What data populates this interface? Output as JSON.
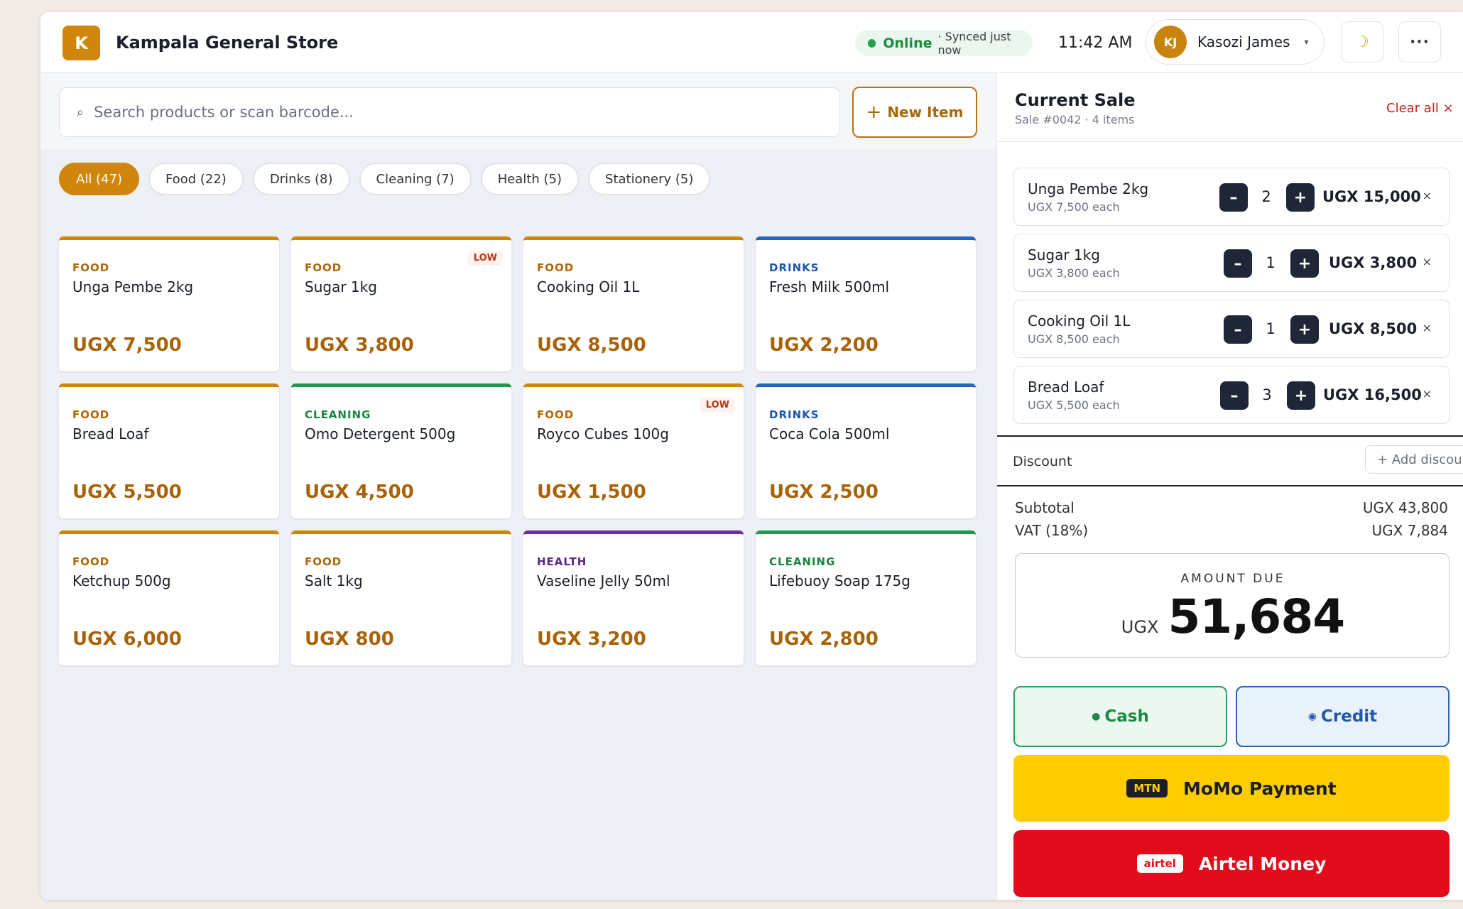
{
  "header": {
    "logo_letter": "K",
    "store_name": "Kampala General Store",
    "status_online": "Online",
    "status_sync": "· Synced just now",
    "time": "11:42 AM",
    "user_initials": "KJ",
    "user_name": "Kasozi James",
    "caret": "▾",
    "moon_glyph": "☽",
    "more_glyph": "···"
  },
  "search": {
    "placeholder": "Search products or scan barcode...",
    "new_item_label": "New Item"
  },
  "filters": [
    {
      "label": "All (47)",
      "active": true
    },
    {
      "label": "Food (22)",
      "active": false
    },
    {
      "label": "Drinks (8)",
      "active": false
    },
    {
      "label": "Cleaning (7)",
      "active": false
    },
    {
      "label": "Health (5)",
      "active": false
    },
    {
      "label": "Stationery (5)",
      "active": false
    }
  ],
  "products": [
    {
      "category": "FOOD",
      "name": "Unga Pembe 2kg",
      "price": "UGX 7,500",
      "badge": ""
    },
    {
      "category": "FOOD",
      "name": "Sugar 1kg",
      "price": "UGX 3,800",
      "badge": "LOW"
    },
    {
      "category": "FOOD",
      "name": "Cooking Oil 1L",
      "price": "UGX 8,500",
      "badge": ""
    },
    {
      "category": "DRINKS",
      "name": "Fresh Milk 500ml",
      "price": "UGX 2,200",
      "badge": ""
    },
    {
      "category": "FOOD",
      "name": "Bread Loaf",
      "price": "UGX 5,500",
      "badge": ""
    },
    {
      "category": "CLEANING",
      "name": "Omo Detergent 500g",
      "price": "UGX 4,500",
      "badge": ""
    },
    {
      "category": "FOOD",
      "name": "Royco Cubes 100g",
      "price": "UGX 1,500",
      "badge": "LOW"
    },
    {
      "category": "DRINKS",
      "name": "Coca Cola 500ml",
      "price": "UGX 2,500",
      "badge": ""
    },
    {
      "category": "FOOD",
      "name": "Ketchup 500g",
      "price": "UGX 6,000",
      "badge": ""
    },
    {
      "category": "FOOD",
      "name": "Salt 1kg",
      "price": "UGX 800",
      "badge": ""
    },
    {
      "category": "HEALTH",
      "name": "Vaseline Jelly 50ml",
      "price": "UGX 3,200",
      "badge": ""
    },
    {
      "category": "CLEANING",
      "name": "Lifebuoy Soap 175g",
      "price": "UGX 2,800",
      "badge": ""
    }
  ],
  "sale": {
    "title": "Current Sale",
    "subtitle": "Sale #0042 · 4 items",
    "clear_all": "Clear all ×",
    "items": [
      {
        "name": "Unga Pembe 2kg",
        "each": "UGX 7,500 each",
        "qty": "2",
        "total": "UGX 15,000"
      },
      {
        "name": "Sugar 1kg",
        "each": "UGX 3,800 each",
        "qty": "1",
        "total": "UGX 3,800"
      },
      {
        "name": "Cooking Oil 1L",
        "each": "UGX 8,500 each",
        "qty": "1",
        "total": "UGX 8,500"
      },
      {
        "name": "Bread Loaf",
        "each": "UGX 5,500 each",
        "qty": "3",
        "total": "UGX 16,500"
      }
    ],
    "minus_glyph": "–",
    "plus_glyph": "+",
    "remove_glyph": "×",
    "discount_label": "Discount",
    "add_discount": "+ Add discount",
    "subtotal_label": "Subtotal",
    "subtotal_value": "UGX 43,800",
    "vat_label": "VAT (18%)",
    "vat_value": "UGX 7,884",
    "amount_due_label": "AMOUNT DUE",
    "amount_due_currency": "UGX",
    "amount_due_value": "51,684"
  },
  "payments": {
    "cash": "Cash",
    "credit": "Credit",
    "momo_badge": "MTN",
    "momo": "MoMo Payment",
    "airtel_badge": "airtel",
    "airtel": "Airtel Money"
  },
  "colors": {
    "brand": "#d0860a",
    "food": "#d0860a",
    "drinks": "#2566c0",
    "cleaning": "#1f9a4c",
    "health": "#6b2e9e",
    "momo": "#ffcc00",
    "airtel": "#e10d1c"
  }
}
